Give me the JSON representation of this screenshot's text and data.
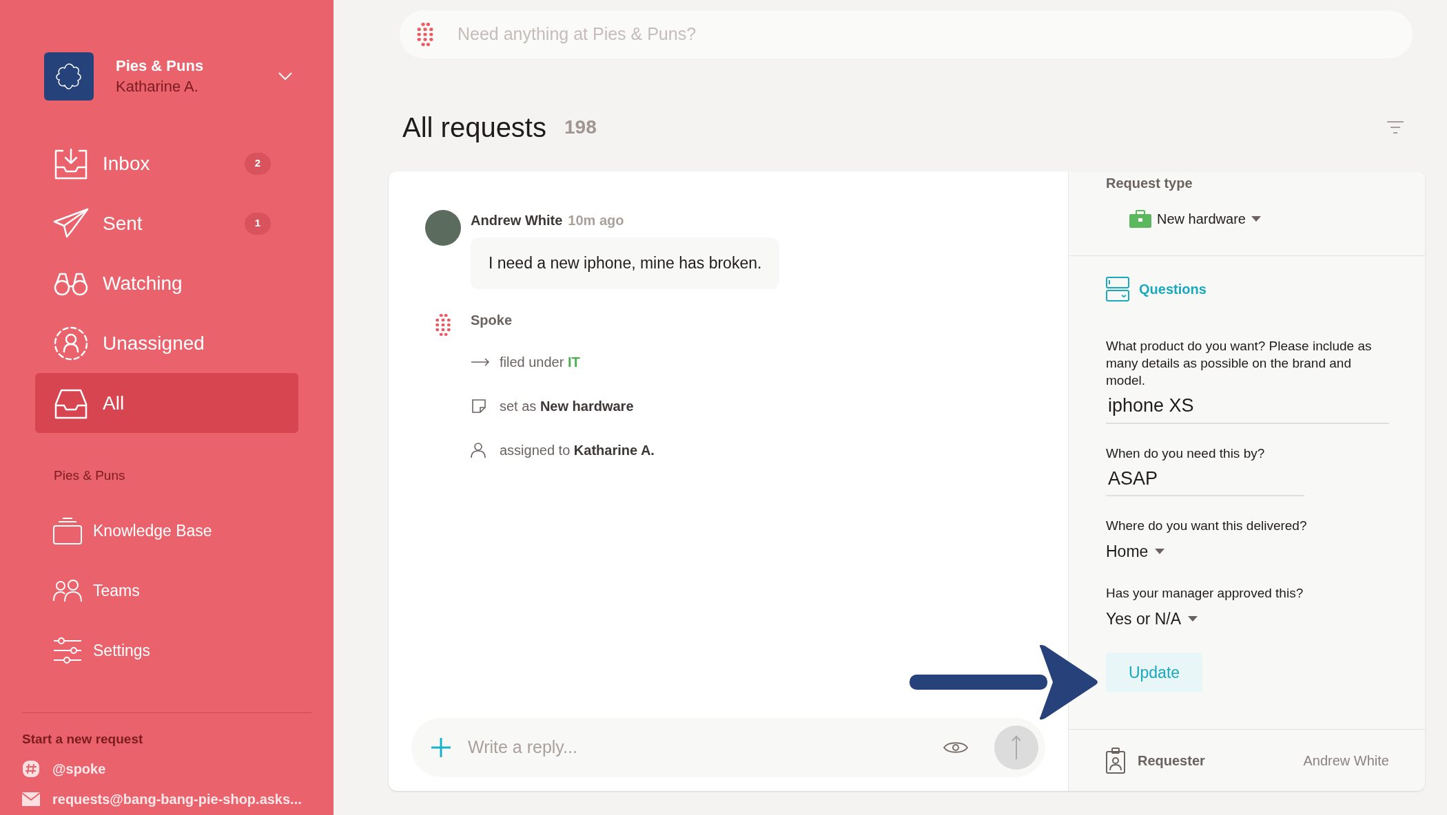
{
  "workspace": {
    "name": "Pies & Puns",
    "user": "Katharine A."
  },
  "nav": [
    {
      "kind": "inbox",
      "label": "Inbox",
      "badge": "2",
      "selected": false
    },
    {
      "kind": "sent",
      "label": "Sent",
      "badge": "1",
      "selected": false
    },
    {
      "kind": "watching",
      "label": "Watching",
      "selected": false
    },
    {
      "kind": "unassigned",
      "label": "Unassigned",
      "selected": false
    },
    {
      "kind": "all",
      "label": "All",
      "selected": true
    }
  ],
  "section": {
    "title": "Pies & Puns",
    "items": [
      {
        "kind": "knowledge",
        "label": "Knowledge Base"
      },
      {
        "kind": "teams",
        "label": "Teams"
      },
      {
        "kind": "settings",
        "label": "Settings"
      }
    ]
  },
  "start_request": {
    "title": "Start a new request",
    "channels": [
      {
        "kind": "slack",
        "label": "@spoke"
      },
      {
        "kind": "email",
        "label": "requests@bang-bang-pie-shop.asks..."
      }
    ]
  },
  "search": {
    "placeholder": "Need anything at Pies & Puns?"
  },
  "header": {
    "title": "All requests",
    "count": "198"
  },
  "message": {
    "author": "Andrew White",
    "time": "10m ago",
    "text": "I need a new iphone, mine has broken."
  },
  "system": {
    "author": "Spoke",
    "events": [
      {
        "kind": "filed",
        "text": "filed under",
        "value": "IT"
      },
      {
        "kind": "type",
        "text": "set as",
        "value": "New hardware"
      },
      {
        "kind": "assigned",
        "text": "assigned to",
        "value": "Katharine A."
      }
    ]
  },
  "reply": {
    "placeholder": "Write a reply..."
  },
  "details": {
    "request_type": {
      "label": "Request type",
      "value": "New hardware"
    },
    "questions": {
      "title": "Questions",
      "items": [
        {
          "kind": "text",
          "question": "What product do you want? Please include as many details as possible on the brand and model.",
          "answer": "iphone XS"
        },
        {
          "kind": "short",
          "question": "When do you need this by?",
          "answer": "ASAP"
        },
        {
          "kind": "select",
          "question": "Where do you want this delivered?",
          "answer": "Home"
        },
        {
          "kind": "select",
          "question": "Has your manager approved this?",
          "answer": "Yes or N/A"
        }
      ]
    },
    "update_button": "Update",
    "requester": {
      "label": "Requester",
      "name": "Andrew White"
    }
  }
}
